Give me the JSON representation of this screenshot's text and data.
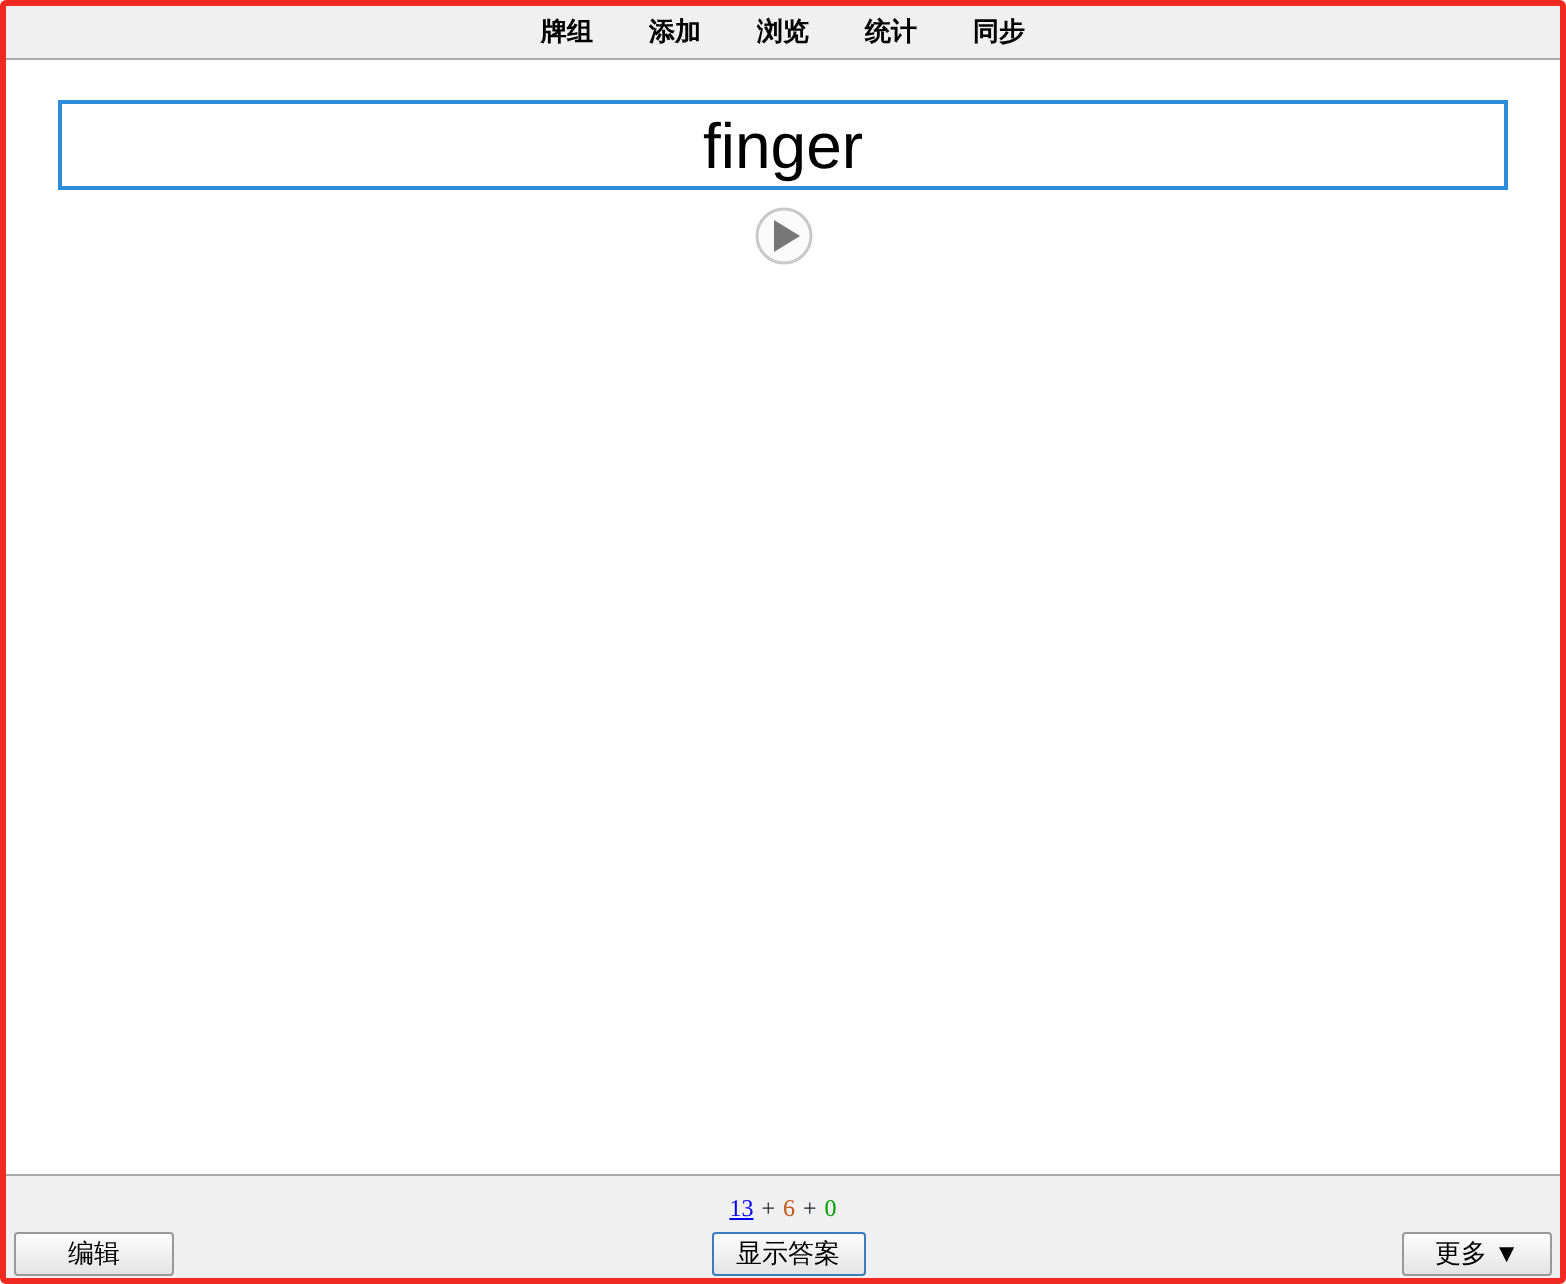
{
  "nav": [
    {
      "label": "牌组"
    },
    {
      "label": "添加"
    },
    {
      "label": "浏览"
    },
    {
      "label": "统计"
    },
    {
      "label": "同步"
    }
  ],
  "answer": {
    "value": "finger"
  },
  "counts": [
    {
      "text": "13",
      "color": "#0000ee",
      "kind": "link"
    },
    {
      "text": "+",
      "kind": "sep"
    },
    {
      "text": "6",
      "color": "#c35617",
      "kind": "count"
    },
    {
      "text": "+",
      "kind": "sep"
    },
    {
      "text": "0",
      "color": "#00a000",
      "kind": "count"
    }
  ],
  "buttons": {
    "left": "编辑",
    "center": "显示答案",
    "right": "更多 ▼"
  }
}
